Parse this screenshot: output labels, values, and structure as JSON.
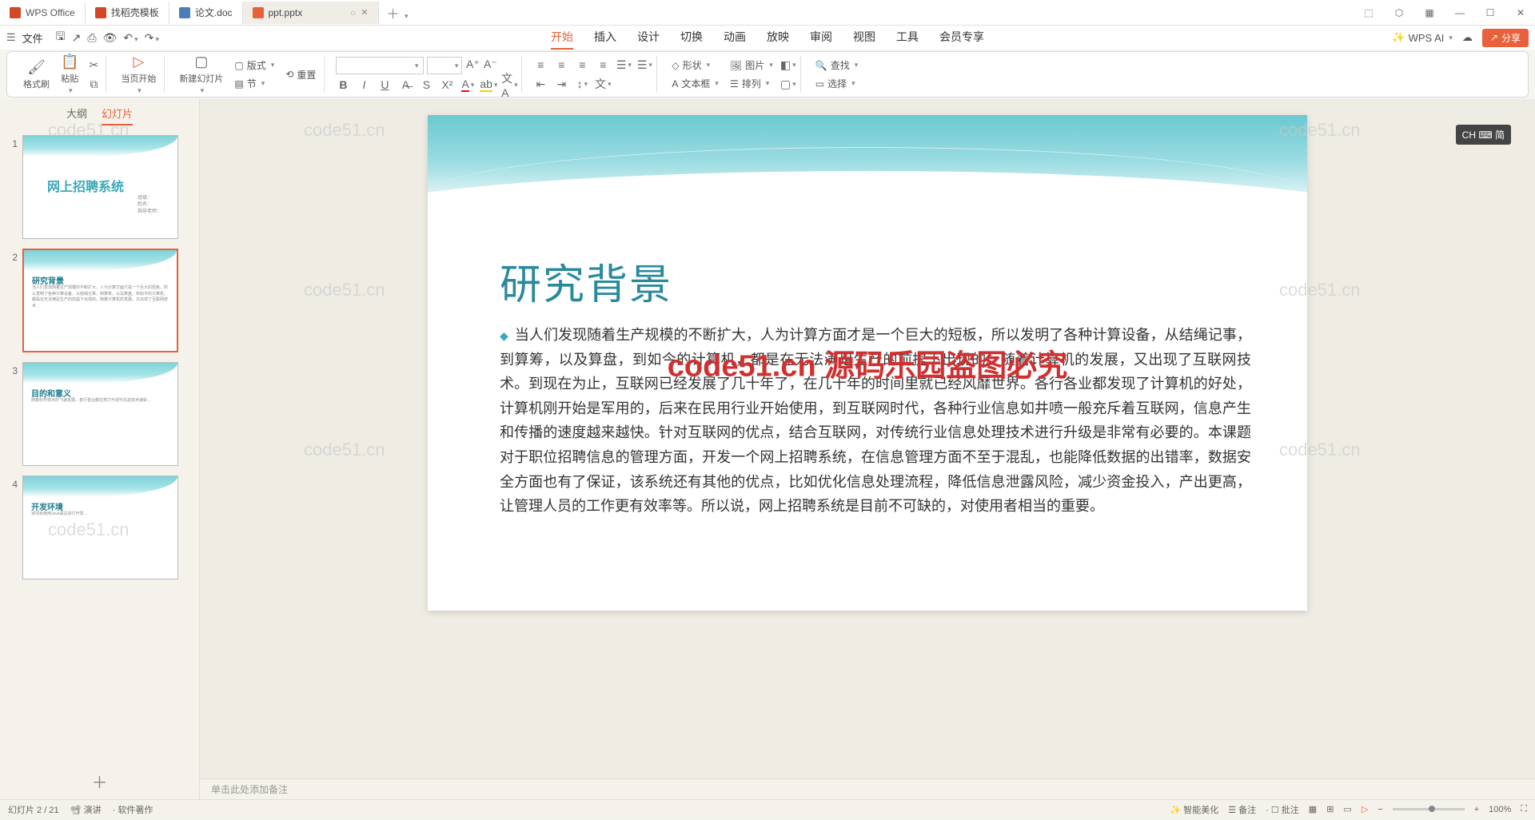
{
  "titlebar": {
    "app": "WPS Office",
    "tabs": [
      {
        "label": "找稻壳模板",
        "icon": "ic-t"
      },
      {
        "label": "论文.doc",
        "icon": "ic-d"
      },
      {
        "label": "ppt.pptx",
        "icon": "ic-p",
        "active": true
      }
    ]
  },
  "menu": {
    "file": "文件",
    "tabs": [
      "开始",
      "插入",
      "设计",
      "切换",
      "动画",
      "放映",
      "审阅",
      "视图",
      "工具",
      "会员专享"
    ],
    "active": "开始",
    "ai": "WPS AI",
    "share": "分享"
  },
  "ribbon": {
    "format_painter": "格式刷",
    "paste": "粘贴",
    "from_slide": "当页开始",
    "new_slide": "新建幻灯片",
    "layout": "版式",
    "section": "节",
    "reset": "重置",
    "font_placeholder": "",
    "size_placeholder": "",
    "shape": "形状",
    "picture": "图片",
    "textbox": "文本框",
    "arrange": "排列",
    "find": "查找",
    "select": "选择"
  },
  "sidepanel": {
    "tab_outline": "大纲",
    "tab_slides": "幻灯片",
    "thumbs": [
      {
        "num": "1",
        "title": "网上招聘系统",
        "meta": "班级：\n姓名：\n指导老师：",
        "big": true
      },
      {
        "num": "2",
        "title": "研究背景",
        "sel": true
      },
      {
        "num": "3",
        "title": "目的和意义"
      },
      {
        "num": "4",
        "title": "开发环境"
      }
    ]
  },
  "slide": {
    "title": "研究背景",
    "body": "当人们发现随着生产规模的不断扩大，人为计算方面才是一个巨大的短板，所以发明了各种计算设备，从结绳记事，到算筹，以及算盘，到如今的计算机，都是在无法满足生产的前提下出现的。随着计算机的发展，又出现了互联网技术。到现在为止，互联网已经发展了几十年了，在几十年的时间里就已经风靡世界。各行各业都发现了计算机的好处，计算机刚开始是军用的，后来在民用行业开始使用，到互联网时代，各种行业信息如井喷一般充斥着互联网，信息产生和传播的速度越来越快。针对互联网的优点，结合互联网，对传统行业信息处理技术进行升级是非常有必要的。本课题对于职位招聘信息的管理方面，开发一个网上招聘系统，在信息管理方面不至于混乱，也能降低数据的出错率，数据安全方面也有了保证，该系统还有其他的优点，比如优化信息处理流程，降低信息泄露风险，减少资金投入，产出更高，让管理人员的工作更有效率等。所以说，网上招聘系统是目前不可缺的，对使用者相当的重要。",
    "watermark_overlay": "code51.cn 源码乐园盗图必究"
  },
  "notes_placeholder": "单击此处添加备注",
  "ime": "CH ⌨ 简",
  "status": {
    "left1": "幻灯片 2 / 21",
    "left2": "演讲",
    "left3": "软件著作",
    "r1": "智能美化",
    "r2": "备注",
    "r3": "批注",
    "zoom": "100%"
  },
  "wm_text": "code51.cn"
}
